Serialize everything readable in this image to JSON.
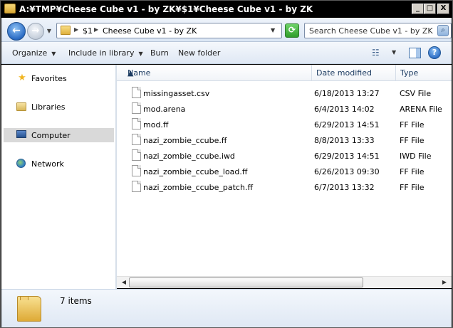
{
  "window": {
    "title": "A:¥TMP¥Cheese Cube v1 - by ZK¥$1¥Cheese Cube v1 - by ZK",
    "minimize": "_",
    "maximize": "□",
    "close": "X"
  },
  "nav": {
    "back": "←",
    "forward": "→",
    "breadcrumb": [
      "$1",
      "Cheese Cube v1 - by ZK"
    ],
    "refresh": "⟳",
    "search_placeholder": "Search Cheese Cube v1 - by ZK"
  },
  "toolbar": {
    "organize": "Organize",
    "include_in_library": "Include in library",
    "burn": "Burn",
    "new_folder": "New folder"
  },
  "sidebar": {
    "items": [
      {
        "label": "Favorites",
        "icon": "star-icon"
      },
      {
        "label": "Libraries",
        "icon": "libraries-icon"
      },
      {
        "label": "Computer",
        "icon": "computer-icon",
        "selected": true
      },
      {
        "label": "Network",
        "icon": "network-icon"
      }
    ]
  },
  "columns": {
    "name": "Name",
    "date_modified": "Date modified",
    "type": "Type"
  },
  "files": [
    {
      "name": "missingasset.csv",
      "date": "6/18/2013 13:27",
      "type": "CSV File"
    },
    {
      "name": "mod.arena",
      "date": "6/4/2013 14:02",
      "type": "ARENA File"
    },
    {
      "name": "mod.ff",
      "date": "6/29/2013 14:51",
      "type": "FF File"
    },
    {
      "name": "nazi_zombie_ccube.ff",
      "date": "8/8/2013 13:33",
      "type": "FF File"
    },
    {
      "name": "nazi_zombie_ccube.iwd",
      "date": "6/29/2013 14:51",
      "type": "IWD File"
    },
    {
      "name": "nazi_zombie_ccube_load.ff",
      "date": "6/26/2013 09:30",
      "type": "FF File"
    },
    {
      "name": "nazi_zombie_ccube_patch.ff",
      "date": "6/7/2013 13:32",
      "type": "FF File"
    }
  ],
  "details": {
    "item_count": "7 items"
  }
}
